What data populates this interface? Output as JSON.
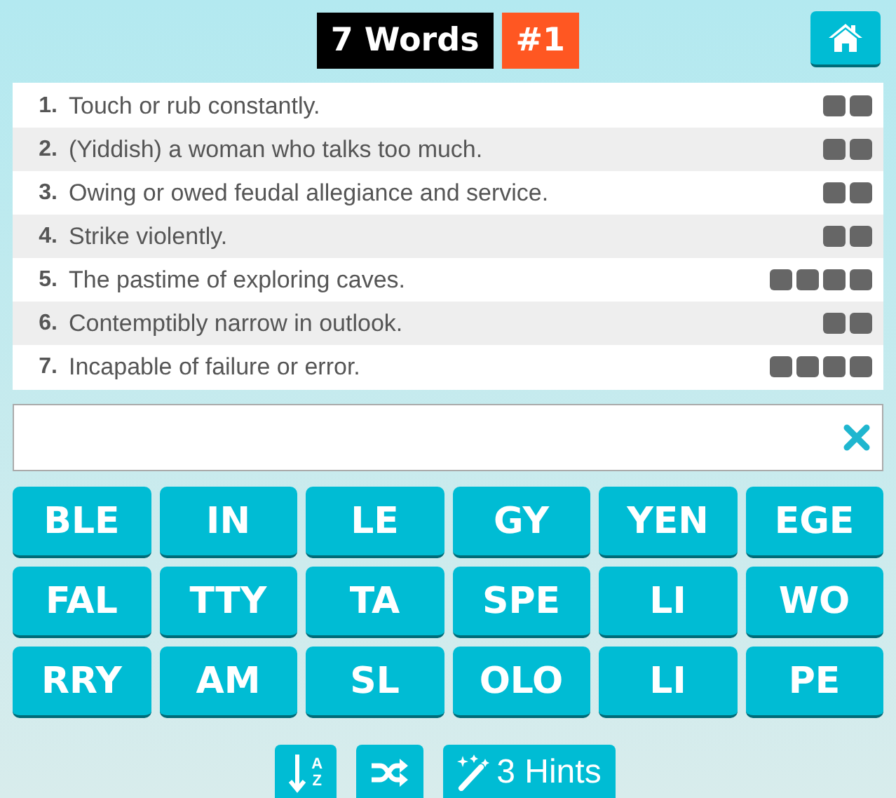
{
  "header": {
    "title": "7 Words",
    "puzzle_number": "#1"
  },
  "clues": [
    {
      "number": "1.",
      "text": "Touch or rub constantly.",
      "slots": [
        {
          "filled": false
        },
        {
          "filled": false
        }
      ]
    },
    {
      "number": "2.",
      "text": "(Yiddish) a woman who talks too much.",
      "slots": [
        {
          "filled": false
        },
        {
          "filled": false
        }
      ]
    },
    {
      "number": "3.",
      "text": "Owing or owed feudal allegiance and service.",
      "slots": [
        {
          "filled": false
        },
        {
          "filled": false
        }
      ]
    },
    {
      "number": "4.",
      "text": "Strike violently.",
      "slots": [
        {
          "filled": false
        },
        {
          "filled": false
        }
      ]
    },
    {
      "number": "5.",
      "text": "The pastime of exploring caves.",
      "slots": [
        {
          "filled": false
        },
        {
          "filled": false
        },
        {
          "filled": false
        },
        {
          "filled": false
        }
      ]
    },
    {
      "number": "6.",
      "text": "Contemptibly narrow in outlook.",
      "slots": [
        {
          "filled": false
        },
        {
          "filled": false
        }
      ]
    },
    {
      "number": "7.",
      "text": "Incapable of failure or error.",
      "slots": [
        {
          "filled": false
        },
        {
          "filled": false
        },
        {
          "filled": false
        },
        {
          "filled": false
        }
      ]
    }
  ],
  "tiles": [
    "BLE",
    "IN",
    "LE",
    "GY",
    "YEN",
    "EGE",
    "FAL",
    "TTY",
    "TA",
    "SPE",
    "LI",
    "WO",
    "RRY",
    "AM",
    "SL",
    "OLO",
    "LI",
    "PE"
  ],
  "tools": [
    {
      "kind": "sort",
      "letters": [
        "A",
        "Z"
      ]
    },
    {
      "kind": "shuffle"
    },
    {
      "kind": "hints",
      "label": "3 Hints"
    }
  ]
}
